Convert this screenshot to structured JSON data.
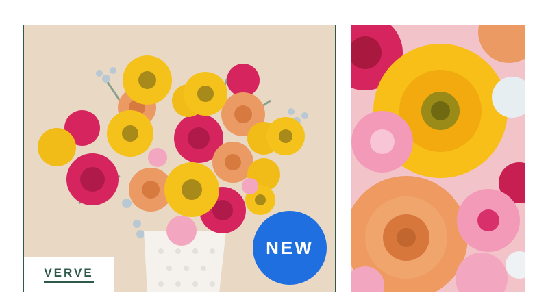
{
  "product": {
    "collection_label": "VERVE",
    "badge_label": "NEW"
  },
  "icons": {
    "main_image": "bouquet-photo",
    "detail_image": "flower-closeup-photo"
  },
  "colors": {
    "border": "#2f5a49",
    "badge": "#1f6fe0",
    "backdrop": "#e9d8c4"
  }
}
